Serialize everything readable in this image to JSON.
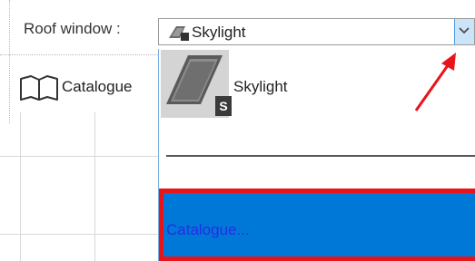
{
  "roof_window": {
    "label": "Roof window :",
    "selected": "Skylight"
  },
  "toolbar": {
    "catalogue_label": "Catalogue"
  },
  "dropdown": {
    "items": [
      {
        "label": "Skylight",
        "badge": "S",
        "icon": "skylight-thumbnail"
      }
    ],
    "catalogue_item": "Catalogue..."
  },
  "colors": {
    "selection_blue": "#0078d7",
    "highlight_red": "#e8141b",
    "dropdown_button": "#cce4f7"
  }
}
